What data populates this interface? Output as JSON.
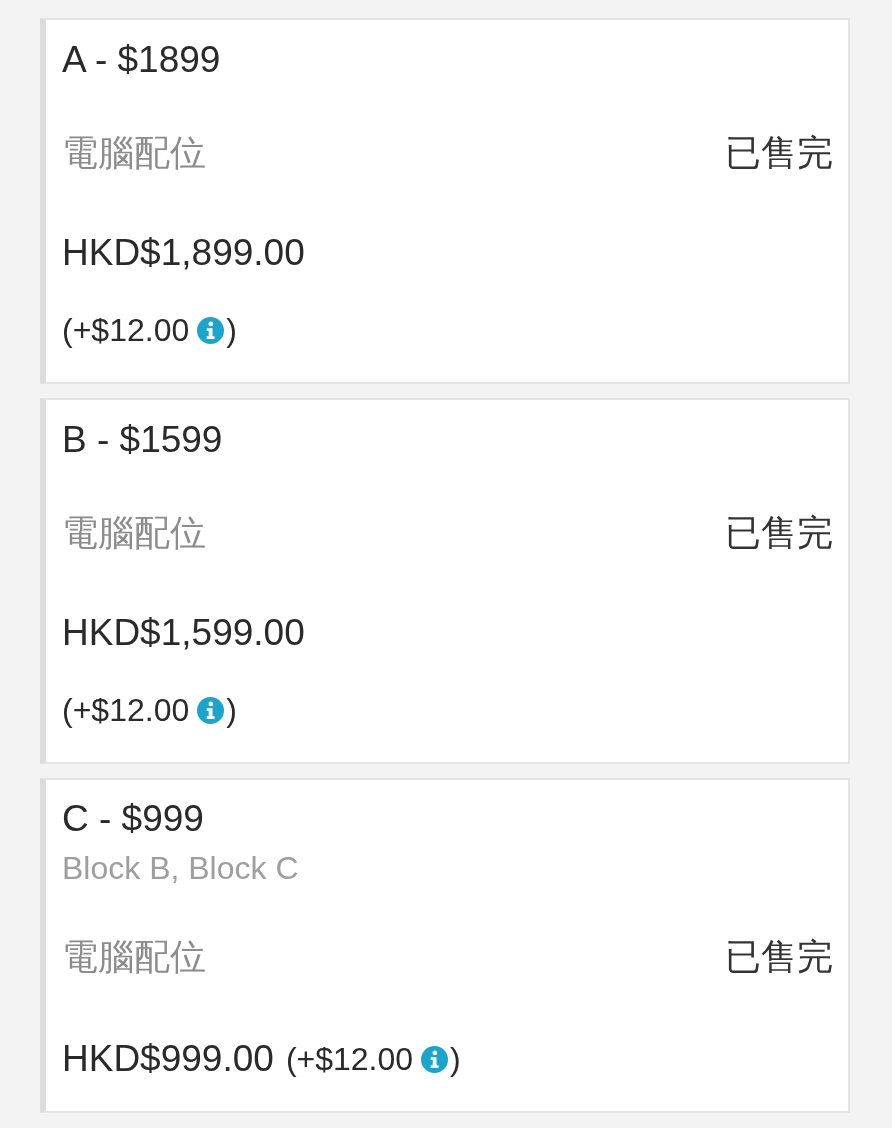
{
  "options": [
    {
      "kind": "stacked",
      "title": "A - $1899",
      "category": "電腦配位",
      "status": "已售完",
      "price": "HKD$1,899.00",
      "fee": "(+$12.00",
      "fee_close": ")"
    },
    {
      "kind": "stacked",
      "title": "B - $1599",
      "category": "電腦配位",
      "status": "已售完",
      "price": "HKD$1,599.00",
      "fee": "(+$12.00",
      "fee_close": ")"
    },
    {
      "kind": "inline",
      "title": "C - $999",
      "blocks": "Block B, Block C",
      "category": "電腦配位",
      "status": "已售完",
      "price": "HKD$999.00",
      "fee": "(+$12.00",
      "fee_close": ")"
    }
  ]
}
